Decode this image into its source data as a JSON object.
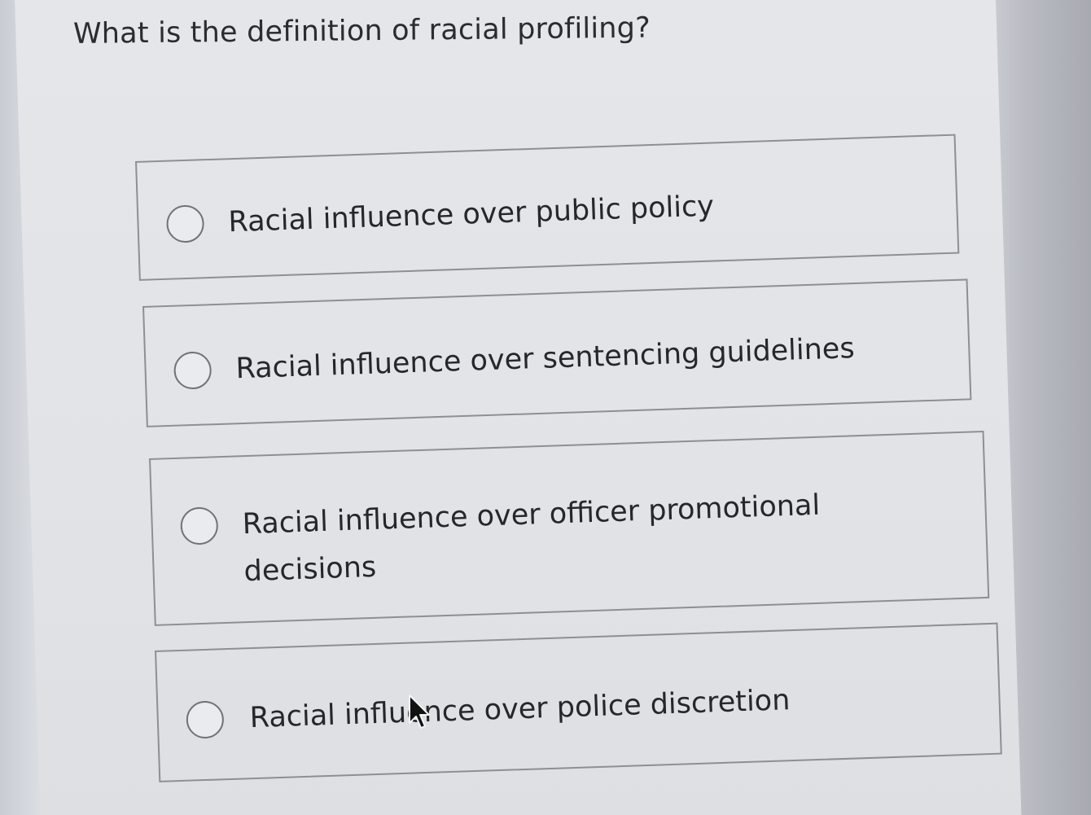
{
  "quiz": {
    "question": "What is the definition of racial profiling?",
    "options": [
      {
        "label": "Racial influence over public policy",
        "selected": false
      },
      {
        "label": "Racial influence over sentencing guidelines",
        "selected": false
      },
      {
        "label": "Racial influence over officer promotional decisions",
        "selected": false
      },
      {
        "label": "Racial influence over police discretion",
        "selected": false
      }
    ]
  },
  "colors": {
    "border": "#8c8f95",
    "text": "#25272c",
    "background": "#e2e4e8"
  },
  "icons": {
    "radio": "radio-circle",
    "cursor": "mouse-pointer-arrow"
  }
}
